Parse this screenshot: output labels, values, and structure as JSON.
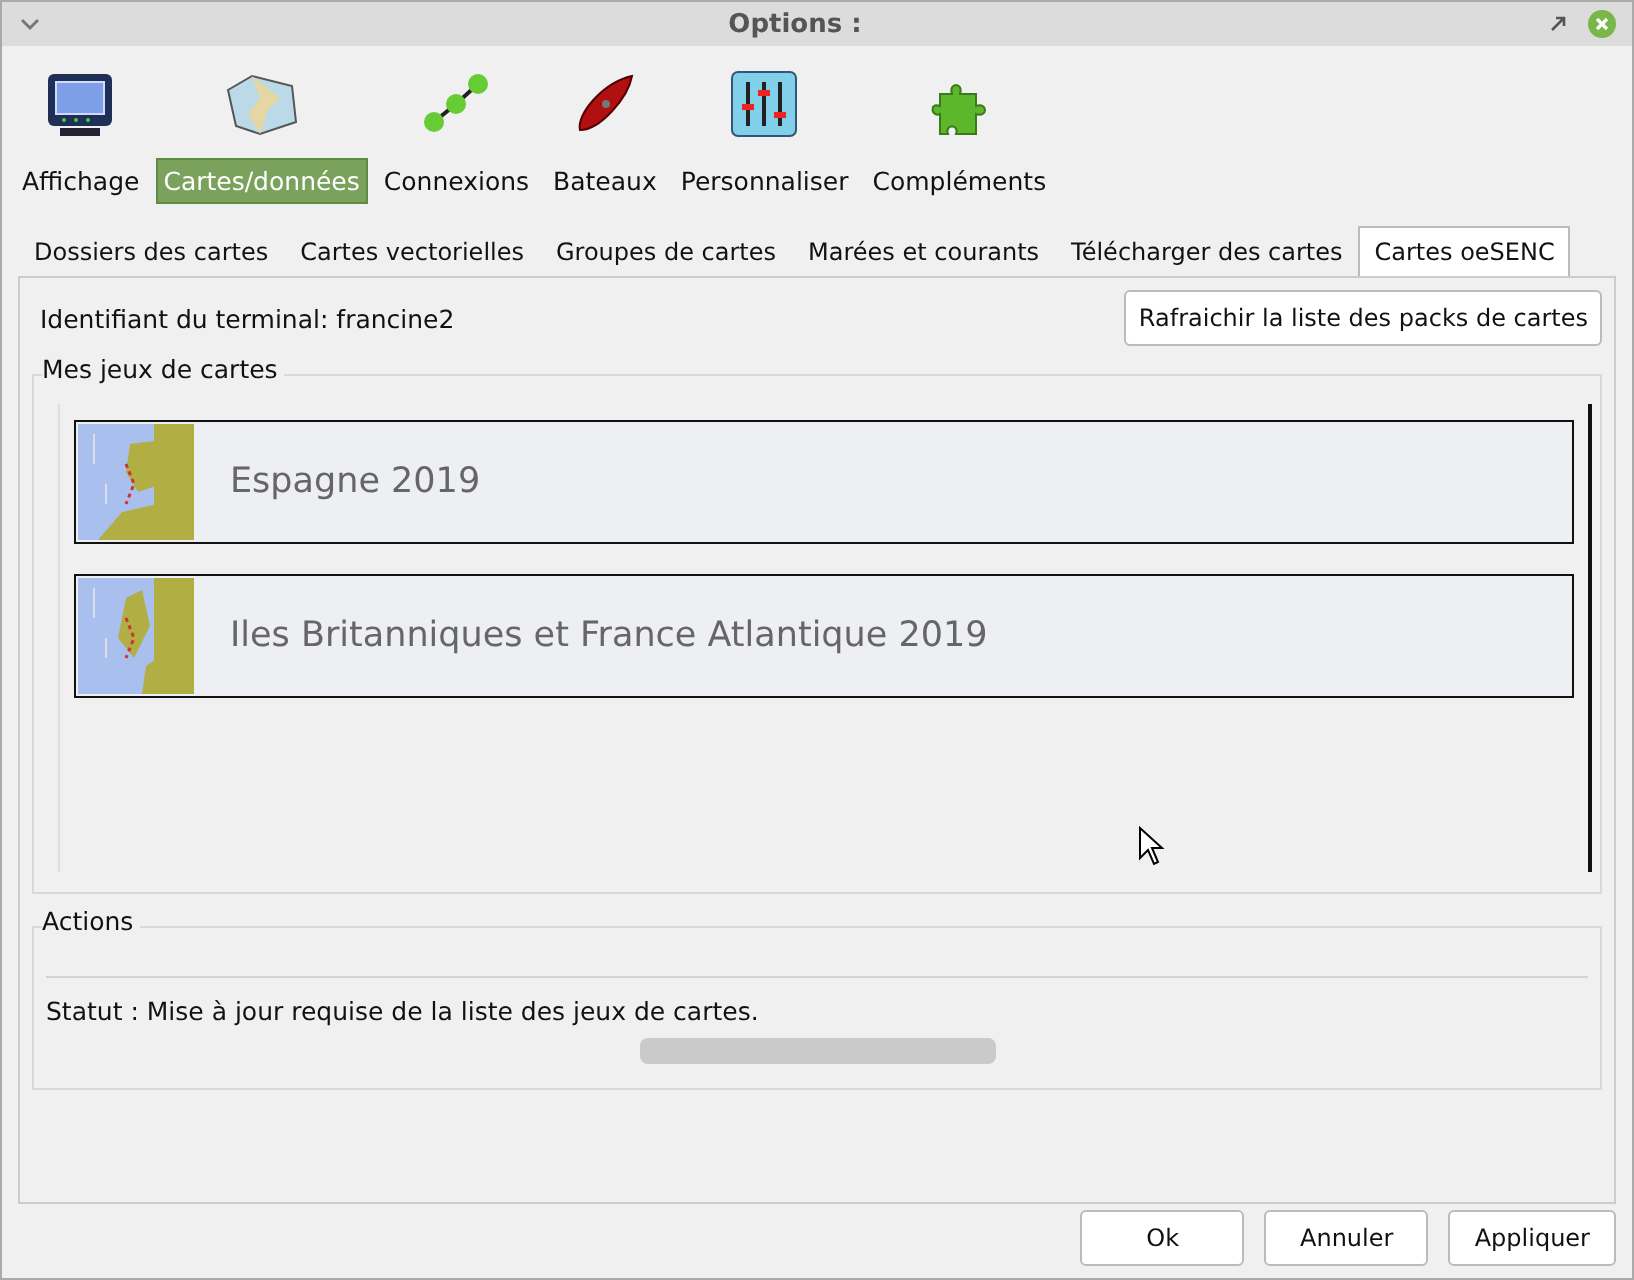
{
  "window": {
    "title": "Options :"
  },
  "categories": [
    {
      "label": "Affichage",
      "kind": "monitor",
      "selected": false
    },
    {
      "label": "Cartes/données",
      "kind": "map",
      "selected": true
    },
    {
      "label": "Connexions",
      "kind": "nodes",
      "selected": false
    },
    {
      "label": "Bateaux",
      "kind": "boat",
      "selected": false
    },
    {
      "label": "Personnaliser",
      "kind": "sliders",
      "selected": false
    },
    {
      "label": "Compléments",
      "kind": "puzzle",
      "selected": false
    }
  ],
  "tabs": [
    {
      "label": "Dossiers des cartes",
      "selected": false
    },
    {
      "label": "Cartes vectorielles",
      "selected": false
    },
    {
      "label": "Groupes de cartes",
      "selected": false
    },
    {
      "label": "Marées et courants",
      "selected": false
    },
    {
      "label": "Télécharger des cartes",
      "selected": false
    },
    {
      "label": "Cartes oeSENC",
      "selected": true
    }
  ],
  "terminal_id": "Identifiant du terminal: francine2",
  "refresh_button": "Rafraichir la liste des packs de cartes",
  "chart_sets": {
    "title": "Mes jeux de cartes",
    "items": [
      {
        "name": "Espagne 2019"
      },
      {
        "name": "Iles Britanniques et France Atlantique 2019"
      }
    ]
  },
  "actions": {
    "title": "Actions",
    "status": "Statut : Mise à jour requise de la liste des jeux de cartes.",
    "progress": {
      "level": 0
    }
  },
  "buttons": [
    "Ok",
    "Annuler",
    "Appliquer"
  ]
}
